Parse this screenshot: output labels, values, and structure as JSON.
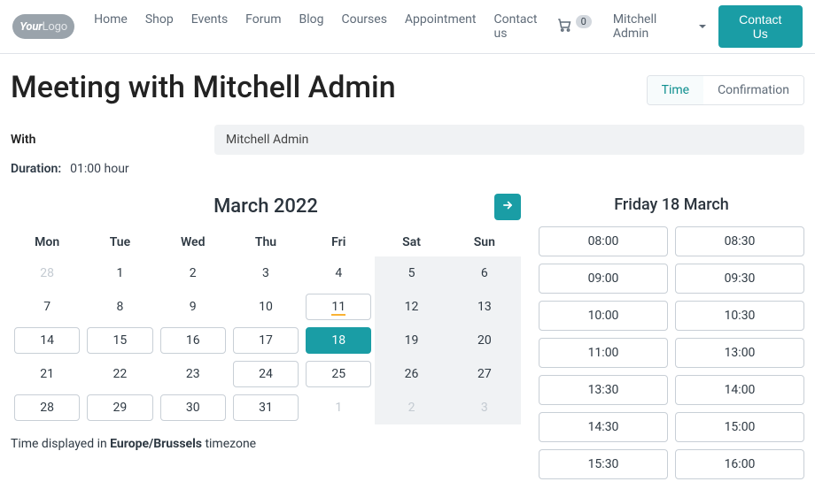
{
  "header": {
    "logo_your": "Your",
    "logo_logo": "Logo",
    "nav": [
      {
        "id": "home",
        "label": "Home"
      },
      {
        "id": "shop",
        "label": "Shop"
      },
      {
        "id": "events",
        "label": "Events"
      },
      {
        "id": "forum",
        "label": "Forum"
      },
      {
        "id": "blog",
        "label": "Blog"
      },
      {
        "id": "courses",
        "label": "Courses"
      },
      {
        "id": "appointment",
        "label": "Appointment"
      },
      {
        "id": "contactus",
        "label": "Contact us"
      }
    ],
    "cart_count": "0",
    "user": "Mitchell Admin",
    "contact_btn": "Contact Us"
  },
  "page_title": "Meeting with Mitchell Admin",
  "steps": {
    "time": "Time",
    "confirmation": "Confirmation"
  },
  "with_label": "With",
  "with_value": "Mitchell Admin",
  "duration_label": "Duration:",
  "duration_value": "01:00 hour",
  "calendar": {
    "title": "March 2022",
    "dow": [
      "Mon",
      "Tue",
      "Wed",
      "Thu",
      "Fri",
      "Sat",
      "Sun"
    ],
    "weeks": [
      [
        {
          "n": "28",
          "other": true
        },
        {
          "n": "1"
        },
        {
          "n": "2"
        },
        {
          "n": "3"
        },
        {
          "n": "4"
        },
        {
          "n": "5",
          "weekend": true
        },
        {
          "n": "6",
          "weekend": true
        }
      ],
      [
        {
          "n": "7"
        },
        {
          "n": "8"
        },
        {
          "n": "9"
        },
        {
          "n": "10"
        },
        {
          "n": "11",
          "bordered": true,
          "underline": true
        },
        {
          "n": "12",
          "weekend": true
        },
        {
          "n": "13",
          "weekend": true
        }
      ],
      [
        {
          "n": "14",
          "bordered": true
        },
        {
          "n": "15",
          "bordered": true
        },
        {
          "n": "16",
          "bordered": true
        },
        {
          "n": "17",
          "bordered": true
        },
        {
          "n": "18",
          "bordered": true,
          "selected": true
        },
        {
          "n": "19",
          "weekend": true
        },
        {
          "n": "20",
          "weekend": true
        }
      ],
      [
        {
          "n": "21"
        },
        {
          "n": "22"
        },
        {
          "n": "23"
        },
        {
          "n": "24",
          "bordered": true
        },
        {
          "n": "25",
          "bordered": true
        },
        {
          "n": "26",
          "weekend": true
        },
        {
          "n": "27",
          "weekend": true
        }
      ],
      [
        {
          "n": "28",
          "bordered": true
        },
        {
          "n": "29",
          "bordered": true
        },
        {
          "n": "30",
          "bordered": true
        },
        {
          "n": "31",
          "bordered": true
        },
        {
          "n": "1",
          "other": true
        },
        {
          "n": "2",
          "other": true,
          "weekend": true
        },
        {
          "n": "3",
          "other": true,
          "weekend": true
        }
      ]
    ]
  },
  "tz": {
    "prefix": "Time displayed in ",
    "zone": "Europe/Brussels",
    "suffix": " timezone"
  },
  "times": {
    "title": "Friday 18 March",
    "slots": [
      "08:00",
      "08:30",
      "09:00",
      "09:30",
      "10:00",
      "10:30",
      "11:00",
      "13:00",
      "13:30",
      "14:00",
      "14:30",
      "15:00",
      "15:30",
      "16:00"
    ]
  }
}
